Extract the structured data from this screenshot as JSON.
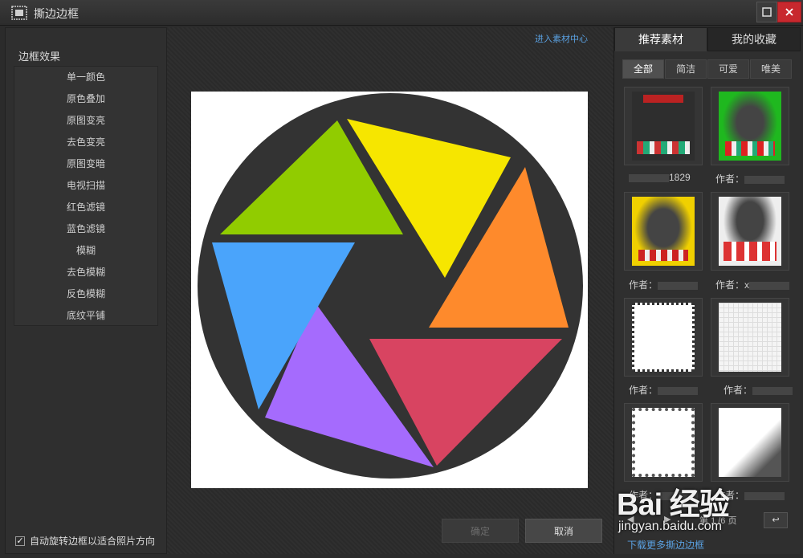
{
  "window": {
    "title": "撕边边框",
    "app_icon": "frame-icon",
    "buttons": {
      "maximize": "maximize-icon",
      "close": "close-icon"
    }
  },
  "left": {
    "heading": "边框效果",
    "effects": [
      "单一颜色",
      "原色叠加",
      "原图变亮",
      "去色变亮",
      "原图变暗",
      "电视扫描",
      "红色滤镜",
      "蓝色滤镜",
      "模糊",
      "去色模糊",
      "反色模糊",
      "底纹平铺"
    ],
    "auto_rotate_checked": true,
    "auto_rotate_label": "自动旋转边框以适合照片方向"
  },
  "center": {
    "material_link": "进入素材中心",
    "preview_colors": {
      "ring": "#333333",
      "yellow": "#f6e600",
      "orange": "#fe8a2c",
      "red": "#d84461",
      "purple": "#a56bfd",
      "blue": "#4aa4fb",
      "green": "#91cc00"
    },
    "confirm_label": "确定",
    "cancel_label": "取消"
  },
  "right": {
    "tabs": [
      "推荐素材",
      "我的收藏"
    ],
    "filters": [
      "全部",
      "简洁",
      "可爱",
      "唯美"
    ],
    "thumbnails": [
      {
        "author": "1829"
      },
      {
        "author": "作者："
      },
      {
        "author": "作者："
      },
      {
        "author": "作者：x"
      },
      {
        "author": "作者："
      },
      {
        "author": "作者："
      },
      {
        "author": "作者："
      },
      {
        "author": "作者："
      }
    ],
    "pager": {
      "page_prefix": "第",
      "current": "1",
      "total": "/6 页",
      "prev_icon": "chevron-left-icon",
      "next_icon": "chevron-right-icon",
      "go_icon": "return-arrow-icon"
    },
    "download_link": "下载更多撕边边框"
  },
  "watermark": {
    "logo": "Bai 经验",
    "url": "jingyan.baidu.com"
  }
}
